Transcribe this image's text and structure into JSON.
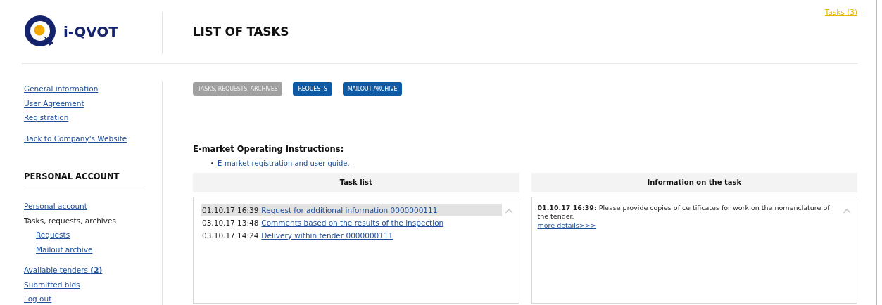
{
  "logo": {
    "text": "i-QVOT"
  },
  "tasks_link": "Tasks (3)",
  "page_title": "LIST OF TASKS",
  "sidebar": {
    "groups": [
      {
        "items": [
          {
            "label": "General information",
            "kind": "link",
            "selected": false
          },
          {
            "label": "User Agreement",
            "kind": "link",
            "selected": false
          },
          {
            "label": "Registration",
            "kind": "link",
            "selected": false
          }
        ]
      },
      {
        "items": [
          {
            "label": "Back to Company's Website",
            "kind": "link",
            "selected": false
          }
        ]
      }
    ],
    "account_heading": "PERSONAL ACCOUNT",
    "account_items": [
      {
        "label": "Personal account",
        "selected": false
      },
      {
        "label": "Tasks, requests, archives",
        "selected": true,
        "children": [
          {
            "label": "Requests",
            "selected": false
          },
          {
            "label": "Mailout archive",
            "selected": false
          }
        ]
      }
    ],
    "extra_items": [
      {
        "label": "Available tenders **(2)**",
        "selected": false
      },
      {
        "label": "Submitted bids",
        "selected": false
      },
      {
        "label": "Log out",
        "selected": false
      }
    ]
  },
  "tabs": [
    {
      "label": "TASKS, REQUESTS, ARCHIVES",
      "selected": true
    },
    {
      "label": "REQUESTS",
      "selected": false
    },
    {
      "label": "MAILOUT ARCHIVE",
      "selected": false
    }
  ],
  "instructions": {
    "heading": "E-market Operating Instructions:",
    "links": [
      "E-market registration and user guide."
    ]
  },
  "task_list": {
    "heading": "Task list",
    "rows": [
      {
        "time": "01.10.17 16:39",
        "title": "Request for additional information 0000000111",
        "selected": true
      },
      {
        "time": "03.10.17 13:48",
        "title": "Comments based on the results of the inspection",
        "selected": false
      },
      {
        "time": "03.10.17 14:24",
        "title": "Delivery within tender 0000000111",
        "selected": false
      }
    ]
  },
  "task_info": {
    "heading": "Information on the task",
    "text": "**01.10.17 16:39:** Please provide copies of certificates for work on the nomenclature of the tender.",
    "link": "more details>>>"
  }
}
